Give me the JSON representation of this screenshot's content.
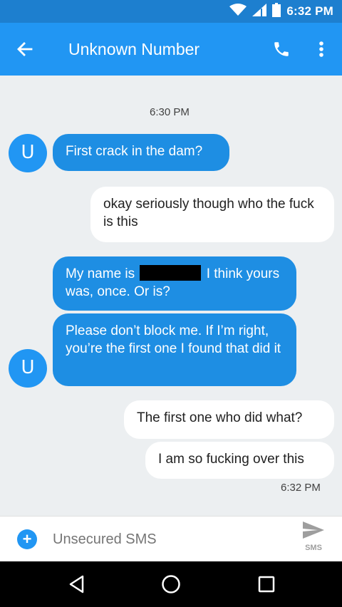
{
  "status_bar": {
    "time": "6:32 PM",
    "icons": [
      "wifi-icon",
      "cell-signal-icon",
      "battery-icon"
    ]
  },
  "toolbar": {
    "title": "Unknown Number",
    "icons": [
      "back-arrow-icon",
      "phone-icon",
      "more-vert-icon"
    ]
  },
  "conversation": {
    "timestamp_top": "6:30 PM",
    "timestamp_bottom": "6:32 PM",
    "contact_initial": "U",
    "messages": [
      {
        "direction": "incoming",
        "text": "First crack in the dam?"
      },
      {
        "direction": "outgoing",
        "text": "okay seriously though who the fuck is this"
      },
      {
        "direction": "incoming",
        "text_before": "My name is",
        "text_after": "I think yours was, once. Or is?"
      },
      {
        "direction": "incoming",
        "text": "Please don’t block me. If I’m right, you’re the first one I found that did it"
      },
      {
        "direction": "outgoing",
        "text": "The first one who did what?"
      },
      {
        "direction": "outgoing",
        "text": "I am so fucking over this"
      }
    ]
  },
  "composer": {
    "placeholder": "Unsecured SMS",
    "send_label": "SMS"
  },
  "colors": {
    "status_bar": "#1d7fcf",
    "toolbar": "#2196f3",
    "incoming_bubble": "#1e8ee3",
    "outgoing_bubble": "#ffffff",
    "background": "#eceff1"
  }
}
